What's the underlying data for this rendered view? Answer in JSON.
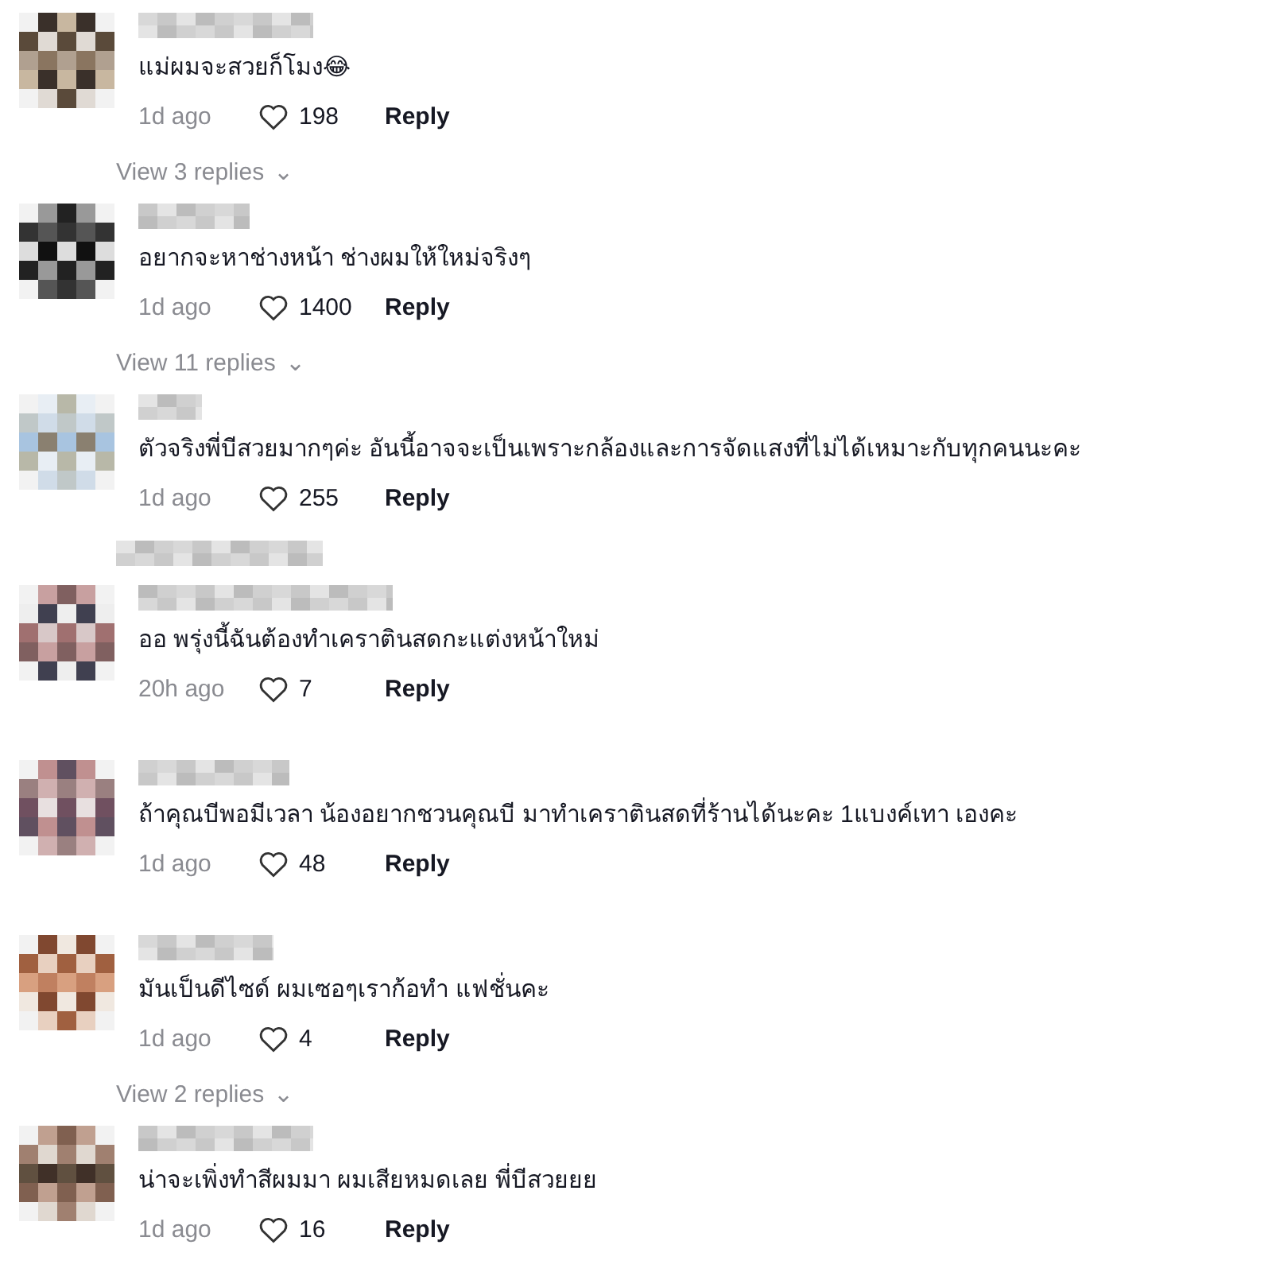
{
  "comments": [
    {
      "text": "แม่ผมจะสวยก็โมง😂",
      "time": "1d ago",
      "likes": "198",
      "reply": "Reply",
      "footer": {
        "kind": "view_replies",
        "text": "View 3 replies",
        "caret": "⌄"
      }
    },
    {
      "text": "อยากจะหาช่างหน้า ช่างผมให้ใหม่จริงๆ",
      "time": "1d ago",
      "likes": "1400",
      "reply": "Reply",
      "footer": {
        "kind": "view_replies",
        "text": "View 11 replies",
        "caret": "⌄"
      }
    },
    {
      "text": "ตัวจริงพี่บีสวยมากๆค่ะ อันนี้อาจจะเป็นเพราะกล้องและการจัดแสงที่ไม่ได้เหมาะกับทุกคนนะคะ",
      "time": "1d ago",
      "likes": "255",
      "reply": "Reply",
      "footer": {
        "kind": "blurred"
      }
    },
    {
      "text": "ออ พรุ่งนี้ฉันต้องทำเคราตินสดกะแต่งหน้าใหม่",
      "time": "20h ago",
      "likes": "7",
      "reply": "Reply"
    },
    {
      "text": "ถ้าคุณบีพอมีเวลา น้องอยากชวนคุณบี มาทำเคราตินสดที่ร้านได้นะคะ 1แบงค์เทา เองคะ",
      "time": "1d ago",
      "likes": "48",
      "reply": "Reply"
    },
    {
      "text": "มันเป็นดีไซด์ ผมเซอๆเราก้อทำ แฟชั่นคะ",
      "time": "1d ago",
      "likes": "4",
      "reply": "Reply",
      "footer": {
        "kind": "view_replies",
        "text": "View 2 replies",
        "caret": "⌄"
      }
    },
    {
      "text": "น่าจะเพิ่งทำสีผมมา ผมเสียหมดเลย พี่บีสวยยย",
      "time": "1d ago",
      "likes": "16",
      "reply": "Reply"
    }
  ]
}
